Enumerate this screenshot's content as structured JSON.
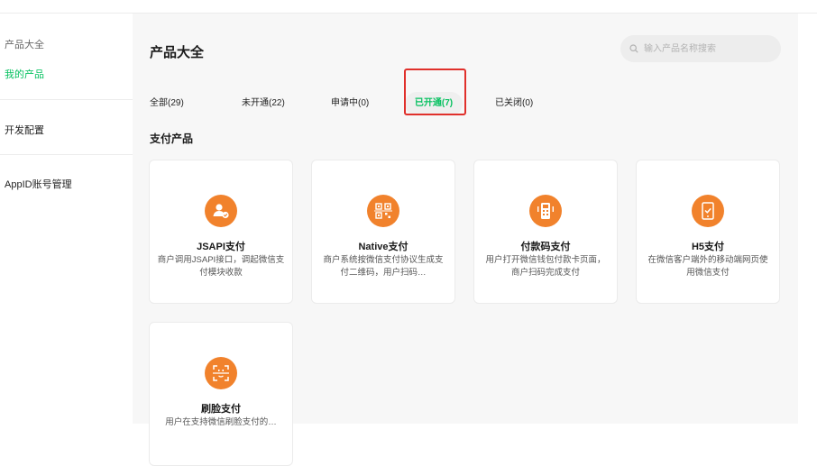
{
  "sidebar": {
    "items": [
      {
        "label": "产品大全",
        "active": false
      },
      {
        "label": "我的产品",
        "active": true
      },
      {
        "label": "开发配置",
        "active": false
      },
      {
        "label": "AppID账号管理",
        "active": false
      }
    ]
  },
  "main": {
    "title": "产品大全",
    "search": {
      "placeholder": "输入产品名称搜索",
      "value": ""
    },
    "tabs": [
      {
        "label": "全部(29)"
      },
      {
        "label": "未开通(22)"
      },
      {
        "label": "申请中(0)"
      },
      {
        "label": "已开通(7)",
        "active": true
      },
      {
        "label": "已关闭(0)"
      }
    ],
    "section_title": "支付产品",
    "products": [
      {
        "name": "JSAPI支付",
        "desc": "商户调用JSAPI接口，调起微信支付模块收款",
        "icon": "user-check-icon"
      },
      {
        "name": "Native支付",
        "desc": "商户系统按微信支付协议生成支付二维码，用户扫码…",
        "icon": "qr-code-icon"
      },
      {
        "name": "付款码支付",
        "desc": "用户打开微信钱包付款卡页面，商户扫码完成支付",
        "icon": "pos-scanner-icon"
      },
      {
        "name": "H5支付",
        "desc": "在微信客户端外的移动端网页使用微信支付",
        "icon": "mobile-check-icon"
      },
      {
        "name": "刷脸支付",
        "desc": "用户在支持微信刷脸支付的…",
        "icon": "face-scan-icon"
      }
    ]
  },
  "colors": {
    "accent_green": "#07c160",
    "icon_orange": "#f1822c",
    "highlight_red": "#e0302b"
  }
}
